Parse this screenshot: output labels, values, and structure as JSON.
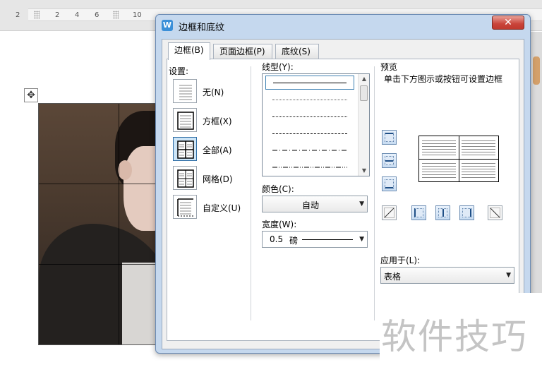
{
  "ruler": {
    "numbers": [
      "2",
      "2",
      "4",
      "6",
      "8",
      "10",
      "1"
    ]
  },
  "dialog": {
    "app_icon": "W",
    "title": "边框和底纹",
    "close_icon": "✕",
    "tabs": [
      {
        "label": "边框(B)"
      },
      {
        "label": "页面边框(P)"
      },
      {
        "label": "底纹(S)"
      }
    ],
    "settings": {
      "label": "设置:",
      "items": [
        {
          "label": "无(N)",
          "icon": "none-border-icon"
        },
        {
          "label": "方框(X)",
          "icon": "box-border-icon"
        },
        {
          "label": "全部(A)",
          "icon": "all-borders-icon",
          "selected": true
        },
        {
          "label": "网格(D)",
          "icon": "grid-border-icon"
        },
        {
          "label": "自定义(U)",
          "icon": "custom-border-icon"
        }
      ]
    },
    "line_style": {
      "label": "线型(Y):",
      "options": [
        "solid",
        "dotted-fine",
        "dotted",
        "dashed",
        "dash-dot",
        "dash-dot-dot"
      ],
      "selected": "solid"
    },
    "color": {
      "label": "颜色(C):",
      "value": "自动"
    },
    "width": {
      "label": "宽度(W):",
      "value": "0.5",
      "unit": "磅"
    },
    "preview": {
      "label": "预览",
      "hint": "单击下方图示或按钮可设置边框"
    },
    "apply_to": {
      "label": "应用于(L):",
      "value": "表格"
    }
  },
  "watermark": "软件技巧"
}
